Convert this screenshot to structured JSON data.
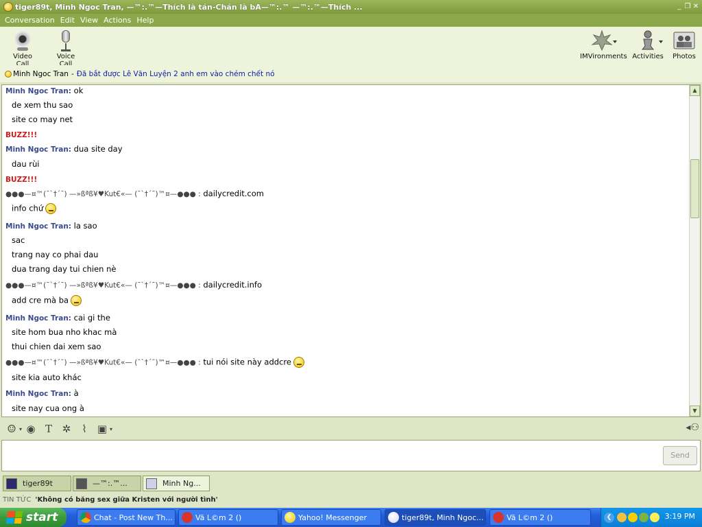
{
  "window": {
    "title": "tiger89t, Minh Ngoc Tran, —™:.™—Thích là tán-Chán là bA—™:.™ —™:.™—Thích ...",
    "controls": [
      "_",
      "❐",
      "✕"
    ]
  },
  "menu": [
    "Conversation",
    "Edit",
    "View",
    "Actions",
    "Help"
  ],
  "toolbar": {
    "left": [
      {
        "label": "Video Call",
        "icon": "webcam-icon"
      },
      {
        "label": "Voice Call",
        "icon": "microphone-icon"
      }
    ],
    "right": [
      {
        "label": "IMVironments",
        "icon": "imvironments-icon"
      },
      {
        "label": "Activities",
        "icon": "activities-icon"
      },
      {
        "label": "Photos",
        "icon": "photos-icon"
      }
    ]
  },
  "status": {
    "name": "Minh Ngoc Tran",
    "separator": "-",
    "message": "Đã bắt được Lê Văn Luyện 2 anh em vào chém chết nó"
  },
  "chat": {
    "messages": [
      {
        "kind": "sender",
        "sender": "Minh Ngoc Tran:",
        "text": "ok"
      },
      {
        "kind": "cont",
        "text": "de xem thu sao"
      },
      {
        "kind": "cont",
        "text": "site co may net"
      },
      {
        "kind": "buzz",
        "text": "BUZZ!!!"
      },
      {
        "kind": "sender",
        "sender": "Minh Ngoc Tran:",
        "text": "dua site day"
      },
      {
        "kind": "cont",
        "text": "dau rùi"
      },
      {
        "kind": "buzz",
        "text": "BUZZ!!!"
      },
      {
        "kind": "fancy",
        "sender": "●●●—¤™(¯`†´¯) —»ßªß¥♥Kut€«— (¯`†´¯)™¤—●●● :",
        "text": "dailycredit.com"
      },
      {
        "kind": "cont",
        "text": "info chứ",
        "emoticon": "grin"
      },
      {
        "kind": "sender",
        "sender": "Minh Ngoc Tran:",
        "text": "la sao"
      },
      {
        "kind": "cont",
        "text": "sac"
      },
      {
        "kind": "cont",
        "text": "trang nay co phai dau"
      },
      {
        "kind": "cont",
        "text": "dua trang day tui chien nè"
      },
      {
        "kind": "fancy",
        "sender": "●●●—¤™(¯`†´¯) —»ßªß¥♥Kut€«— (¯`†´¯)™¤—●●● :",
        "text": "dailycredit.info"
      },
      {
        "kind": "cont",
        "text": "add cre mà ba",
        "emoticon": "straight"
      },
      {
        "kind": "sender",
        "sender": "Minh Ngoc Tran:",
        "text": "cai gi the"
      },
      {
        "kind": "cont",
        "text": "site hom bua nho khac mà"
      },
      {
        "kind": "cont",
        "text": "thui chien dai xem sao"
      },
      {
        "kind": "fancy",
        "sender": "●●●—¤™(¯`†´¯) —»ßªß¥♥Kut€«— (¯`†´¯)™¤—●●● :",
        "text": "tui nói site này addcre",
        "emoticon": "straight"
      },
      {
        "kind": "cont",
        "text": "site kia auto khác"
      },
      {
        "kind": "sender",
        "sender": "Minh Ngoc Tran:",
        "text": "à"
      },
      {
        "kind": "cont",
        "text": "site nay cua ong à"
      }
    ]
  },
  "compose": {
    "send_label": "Send",
    "value": ""
  },
  "tabs": [
    {
      "label": "tiger89t"
    },
    {
      "label": "—™:.™..."
    },
    {
      "label": "Minh Ng..."
    }
  ],
  "news": {
    "label": "TIN TỨC",
    "headline": "'Không có băng sex giữa Kristen với người tình'"
  },
  "taskbar": {
    "start_label": "start",
    "items": [
      {
        "label": "Chat - Post New Th..."
      },
      {
        "label": "Vã L©m 2 ()"
      },
      {
        "label": "Yahoo! Messenger"
      },
      {
        "label": "tiger89t, Minh Ngoc..."
      },
      {
        "label": "Vã L©m 2 ()"
      }
    ],
    "tray_arrow": "❮",
    "clock": "3:19 PM"
  },
  "colors": {
    "titlebar": "#8ba84a",
    "sender_name": "#3a4a8a",
    "buzz": "#d21a1a",
    "status_message": "#0b1fa8"
  }
}
